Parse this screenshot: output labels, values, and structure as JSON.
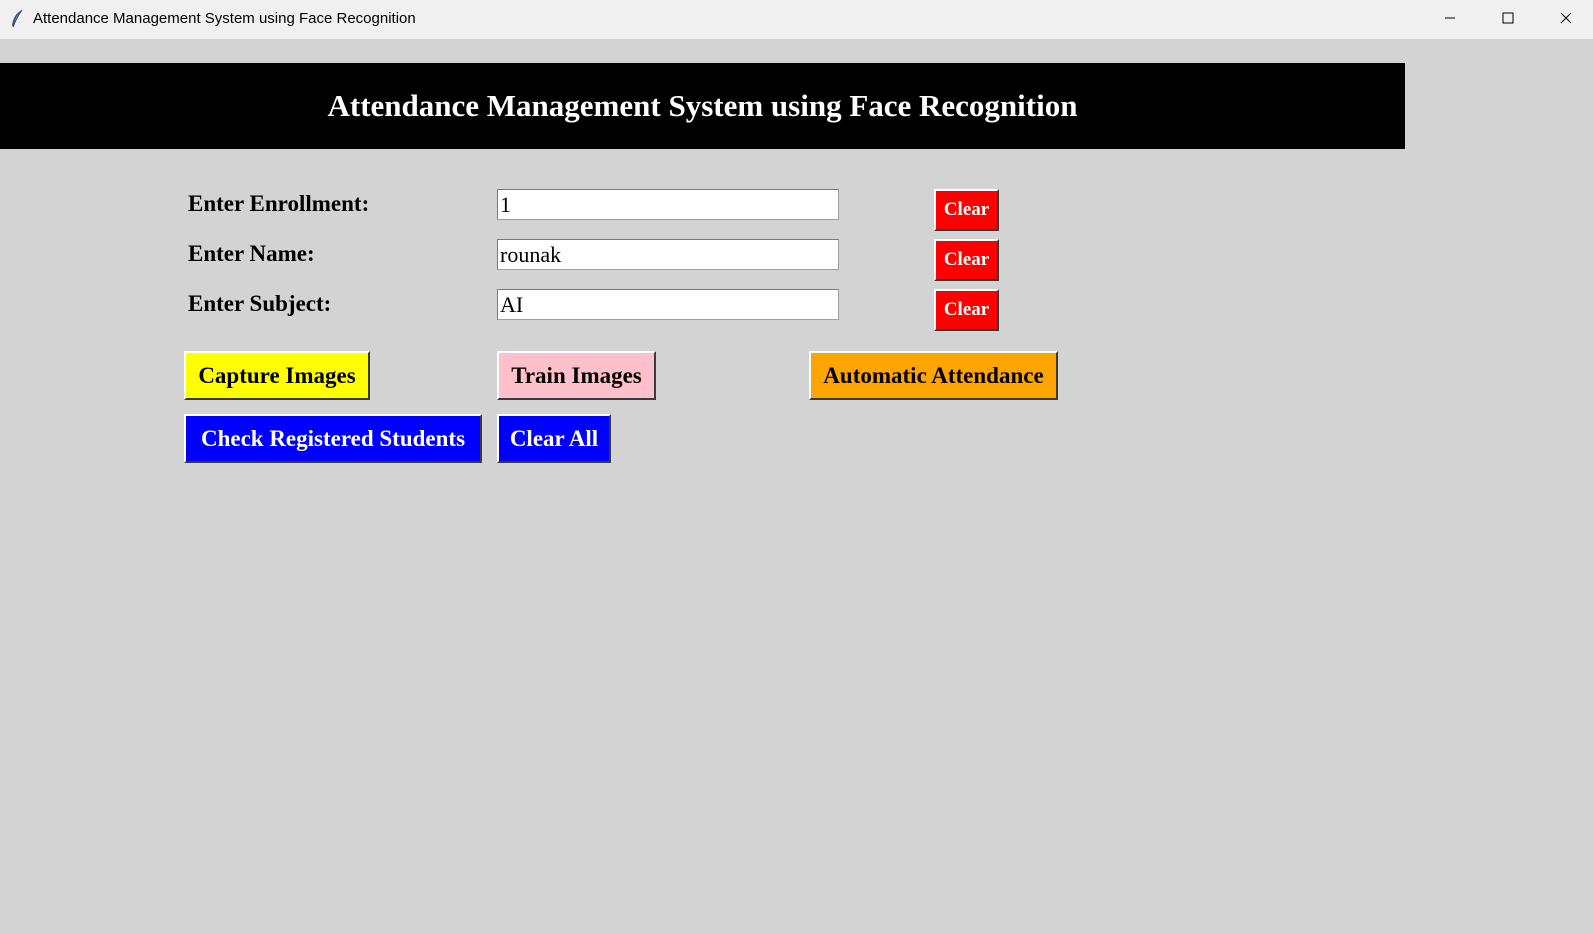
{
  "window": {
    "title": "Attendance Management System using Face Recognition",
    "icon": "feather-icon",
    "controls": [
      "minimize-icon",
      "maximize-icon",
      "close-icon"
    ]
  },
  "header": {
    "title": "Attendance Management System using Face Recognition"
  },
  "form": {
    "enrollment": {
      "label": "Enter Enrollment:",
      "value": "1",
      "clear_label": "Clear"
    },
    "name": {
      "label": "Enter Name:",
      "value": "rounak",
      "clear_label": "Clear"
    },
    "subject": {
      "label": "Enter Subject:",
      "value": "AI",
      "clear_label": "Clear"
    }
  },
  "actions": {
    "capture_label": "Capture Images",
    "train_label": "Train Images",
    "automatic_label": "Automatic Attendance",
    "check_label": "Check Registered Students",
    "clear_all_label": "Clear All"
  },
  "colors": {
    "background": "#d3d3d3",
    "header_bg": "#000000",
    "header_text": "#ffffff",
    "clear_button": "#ff0000",
    "capture_button": "#ffff00",
    "train_button": "#ffc0cb",
    "automatic_button": "#ffa500",
    "blue_button": "#0000ff"
  }
}
